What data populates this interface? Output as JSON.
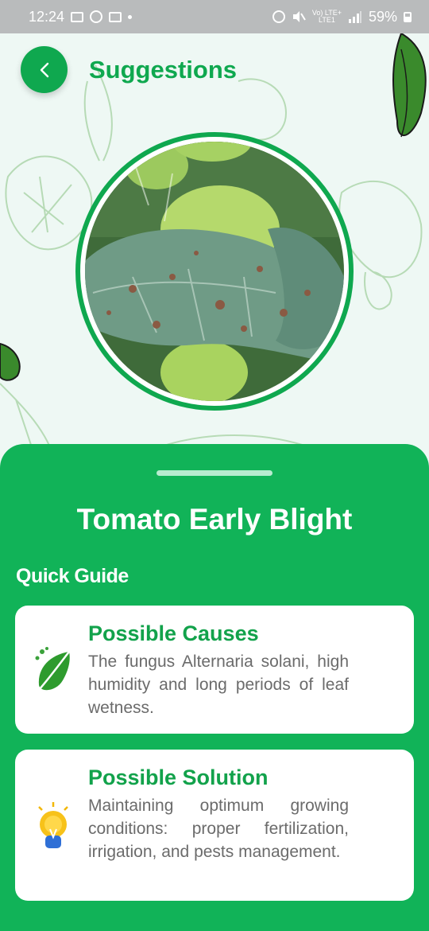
{
  "status_bar": {
    "time": "12:24",
    "battery": "59%",
    "network_top": "Vo) LTE+",
    "network_bottom": "LTE1"
  },
  "header": {
    "title": "Suggestions",
    "back_icon": "chevron-left-icon"
  },
  "sheet": {
    "disease_name": "Tomato Early Blight",
    "section_label": "Quick Guide",
    "cards": [
      {
        "title": "Possible Causes",
        "body": "The fungus Alternaria solani, high humidity and long periods of leaf wetness.",
        "icon": "leaf-icon"
      },
      {
        "title": "Possible Solution",
        "body": "Maintaining optimum growing conditions: proper fertilization, irrigation, and pests management.",
        "icon": "lightbulb-icon"
      }
    ]
  },
  "colors": {
    "brand_green": "#0fa84f",
    "sheet_green": "#11b358",
    "card_title_green": "#12a24b",
    "body_gray": "#6b6b6b",
    "background": "#eef8f4"
  }
}
